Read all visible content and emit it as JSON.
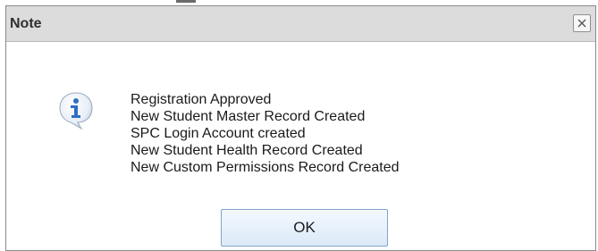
{
  "dialog": {
    "title": "Note",
    "icon": "info-icon",
    "messages": [
      "Registration Approved",
      "New Student Master Record Created",
      "SPC Login Account created",
      "New Student Health Record Created",
      "New Custom Permissions Record Created"
    ],
    "ok_label": "OK",
    "close_icon": "close-icon"
  },
  "colors": {
    "titlebar": "#dcdcdc",
    "border": "#8a8a8a",
    "ok_border": "#7fa5c9",
    "info_blue": "#2f6fc2"
  }
}
